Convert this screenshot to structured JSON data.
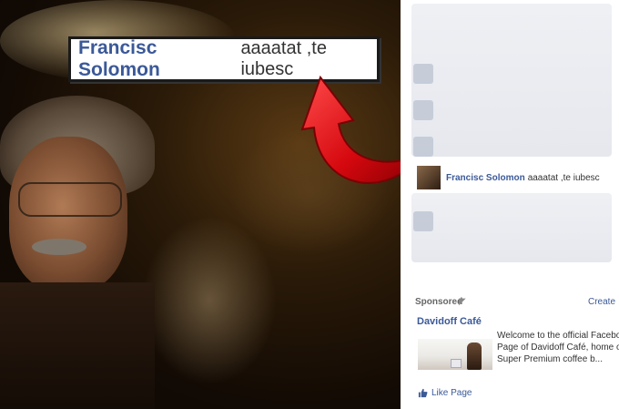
{
  "callout": {
    "name": "Francisc Solomon",
    "message": "aaaatat ,te iubesc"
  },
  "feed": {
    "comment": {
      "name": "Francisc Solomon",
      "message": "aaaatat ,te iubesc"
    }
  },
  "sponsored": {
    "label": "Sponsored",
    "create": "Create",
    "ad_title": "Davidoff Café",
    "ad_desc_lines": [
      "Welcome to the official Faceboo",
      "Page of Davidoff Café, home of th",
      "Super Premium coffee b..."
    ],
    "like_label": "Like Page"
  },
  "colors": {
    "fb_blue": "#3b5998",
    "arrow_red": "#e2141a"
  },
  "icons": {
    "sponsored": "ad-icon",
    "like": "thumbs-up-icon"
  }
}
